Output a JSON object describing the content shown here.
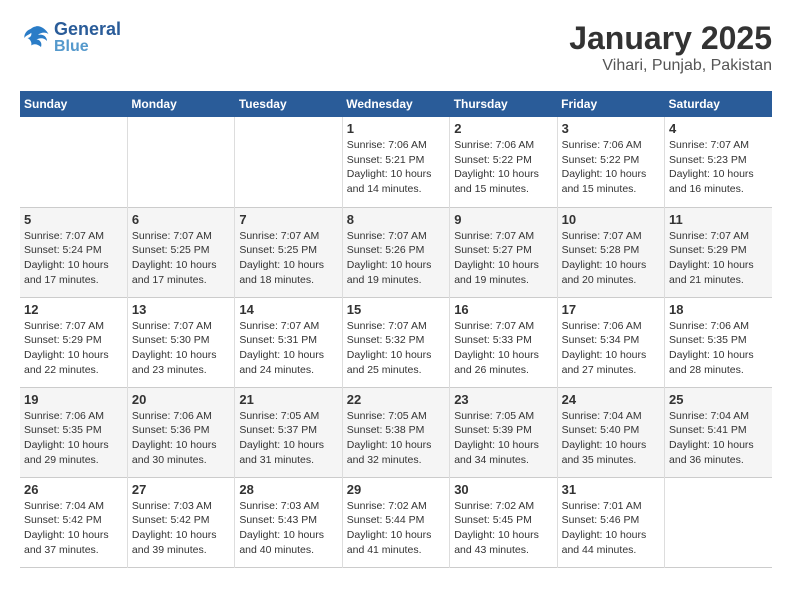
{
  "header": {
    "logo_line1": "General",
    "logo_line2": "Blue",
    "title": "January 2025",
    "subtitle": "Vihari, Punjab, Pakistan"
  },
  "weekdays": [
    "Sunday",
    "Monday",
    "Tuesday",
    "Wednesday",
    "Thursday",
    "Friday",
    "Saturday"
  ],
  "weeks": [
    [
      {
        "day": "",
        "info": ""
      },
      {
        "day": "",
        "info": ""
      },
      {
        "day": "",
        "info": ""
      },
      {
        "day": "1",
        "info": "Sunrise: 7:06 AM\nSunset: 5:21 PM\nDaylight: 10 hours\nand 14 minutes."
      },
      {
        "day": "2",
        "info": "Sunrise: 7:06 AM\nSunset: 5:22 PM\nDaylight: 10 hours\nand 15 minutes."
      },
      {
        "day": "3",
        "info": "Sunrise: 7:06 AM\nSunset: 5:22 PM\nDaylight: 10 hours\nand 15 minutes."
      },
      {
        "day": "4",
        "info": "Sunrise: 7:07 AM\nSunset: 5:23 PM\nDaylight: 10 hours\nand 16 minutes."
      }
    ],
    [
      {
        "day": "5",
        "info": "Sunrise: 7:07 AM\nSunset: 5:24 PM\nDaylight: 10 hours\nand 17 minutes."
      },
      {
        "day": "6",
        "info": "Sunrise: 7:07 AM\nSunset: 5:25 PM\nDaylight: 10 hours\nand 17 minutes."
      },
      {
        "day": "7",
        "info": "Sunrise: 7:07 AM\nSunset: 5:25 PM\nDaylight: 10 hours\nand 18 minutes."
      },
      {
        "day": "8",
        "info": "Sunrise: 7:07 AM\nSunset: 5:26 PM\nDaylight: 10 hours\nand 19 minutes."
      },
      {
        "day": "9",
        "info": "Sunrise: 7:07 AM\nSunset: 5:27 PM\nDaylight: 10 hours\nand 19 minutes."
      },
      {
        "day": "10",
        "info": "Sunrise: 7:07 AM\nSunset: 5:28 PM\nDaylight: 10 hours\nand 20 minutes."
      },
      {
        "day": "11",
        "info": "Sunrise: 7:07 AM\nSunset: 5:29 PM\nDaylight: 10 hours\nand 21 minutes."
      }
    ],
    [
      {
        "day": "12",
        "info": "Sunrise: 7:07 AM\nSunset: 5:29 PM\nDaylight: 10 hours\nand 22 minutes."
      },
      {
        "day": "13",
        "info": "Sunrise: 7:07 AM\nSunset: 5:30 PM\nDaylight: 10 hours\nand 23 minutes."
      },
      {
        "day": "14",
        "info": "Sunrise: 7:07 AM\nSunset: 5:31 PM\nDaylight: 10 hours\nand 24 minutes."
      },
      {
        "day": "15",
        "info": "Sunrise: 7:07 AM\nSunset: 5:32 PM\nDaylight: 10 hours\nand 25 minutes."
      },
      {
        "day": "16",
        "info": "Sunrise: 7:07 AM\nSunset: 5:33 PM\nDaylight: 10 hours\nand 26 minutes."
      },
      {
        "day": "17",
        "info": "Sunrise: 7:06 AM\nSunset: 5:34 PM\nDaylight: 10 hours\nand 27 minutes."
      },
      {
        "day": "18",
        "info": "Sunrise: 7:06 AM\nSunset: 5:35 PM\nDaylight: 10 hours\nand 28 minutes."
      }
    ],
    [
      {
        "day": "19",
        "info": "Sunrise: 7:06 AM\nSunset: 5:35 PM\nDaylight: 10 hours\nand 29 minutes."
      },
      {
        "day": "20",
        "info": "Sunrise: 7:06 AM\nSunset: 5:36 PM\nDaylight: 10 hours\nand 30 minutes."
      },
      {
        "day": "21",
        "info": "Sunrise: 7:05 AM\nSunset: 5:37 PM\nDaylight: 10 hours\nand 31 minutes."
      },
      {
        "day": "22",
        "info": "Sunrise: 7:05 AM\nSunset: 5:38 PM\nDaylight: 10 hours\nand 32 minutes."
      },
      {
        "day": "23",
        "info": "Sunrise: 7:05 AM\nSunset: 5:39 PM\nDaylight: 10 hours\nand 34 minutes."
      },
      {
        "day": "24",
        "info": "Sunrise: 7:04 AM\nSunset: 5:40 PM\nDaylight: 10 hours\nand 35 minutes."
      },
      {
        "day": "25",
        "info": "Sunrise: 7:04 AM\nSunset: 5:41 PM\nDaylight: 10 hours\nand 36 minutes."
      }
    ],
    [
      {
        "day": "26",
        "info": "Sunrise: 7:04 AM\nSunset: 5:42 PM\nDaylight: 10 hours\nand 37 minutes."
      },
      {
        "day": "27",
        "info": "Sunrise: 7:03 AM\nSunset: 5:42 PM\nDaylight: 10 hours\nand 39 minutes."
      },
      {
        "day": "28",
        "info": "Sunrise: 7:03 AM\nSunset: 5:43 PM\nDaylight: 10 hours\nand 40 minutes."
      },
      {
        "day": "29",
        "info": "Sunrise: 7:02 AM\nSunset: 5:44 PM\nDaylight: 10 hours\nand 41 minutes."
      },
      {
        "day": "30",
        "info": "Sunrise: 7:02 AM\nSunset: 5:45 PM\nDaylight: 10 hours\nand 43 minutes."
      },
      {
        "day": "31",
        "info": "Sunrise: 7:01 AM\nSunset: 5:46 PM\nDaylight: 10 hours\nand 44 minutes."
      },
      {
        "day": "",
        "info": ""
      }
    ]
  ]
}
